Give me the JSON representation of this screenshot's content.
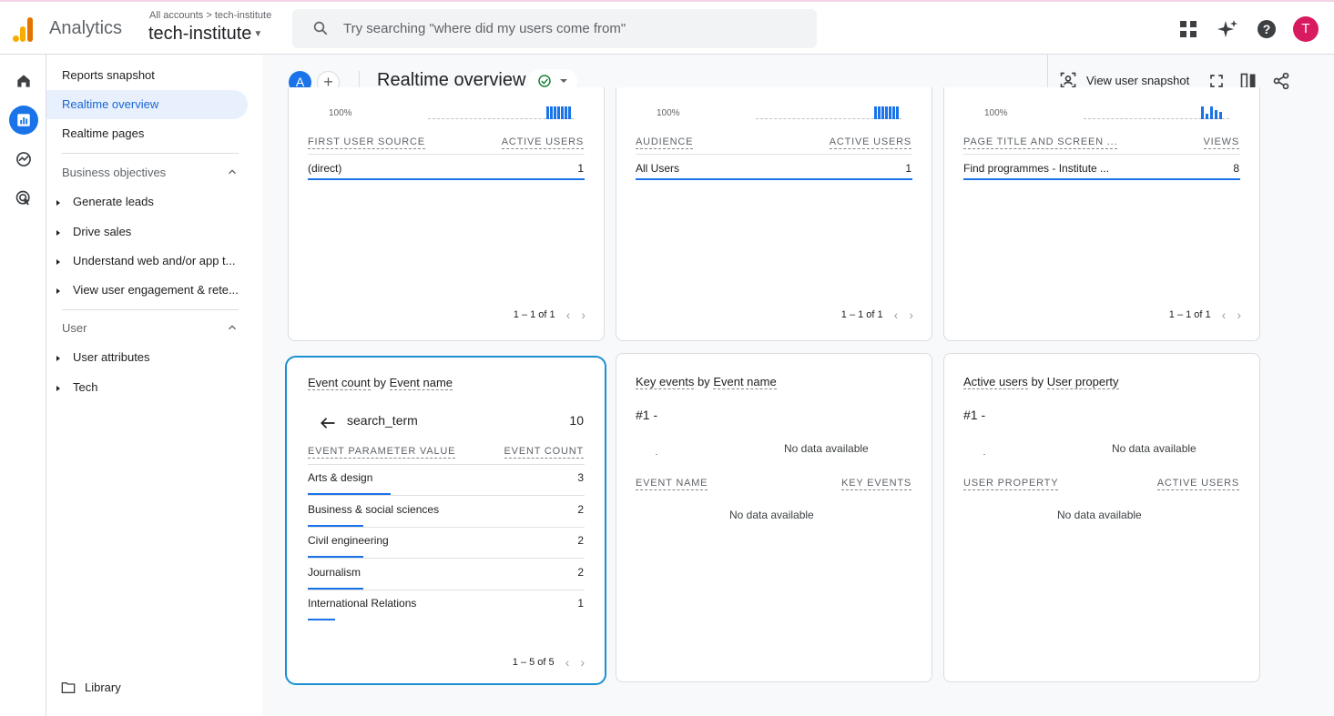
{
  "topbar": {
    "app_title": "Analytics",
    "breadcrumb": "All accounts > tech-institute",
    "property": "tech-institute",
    "search_placeholder": "Try searching \"where did my users come from\"",
    "avatar_letter": "T"
  },
  "nav": {
    "items": [
      {
        "label": "Reports snapshot"
      },
      {
        "label": "Realtime overview"
      },
      {
        "label": "Realtime pages"
      }
    ],
    "business_section": "Business objectives",
    "business_items": [
      "Generate leads",
      "Drive sales",
      "Understand web and/or app t...",
      "View user engagement & rete..."
    ],
    "user_section": "User",
    "user_items": [
      "User attributes",
      "Tech"
    ],
    "library": "Library"
  },
  "header": {
    "comparison_letter": "A",
    "add_symbol": "+",
    "title": "Realtime overview",
    "view_snapshot": "View user snapshot"
  },
  "cards_top": [
    {
      "pct": "100%",
      "col1": "FIRST USER SOURCE",
      "col2": "ACTIVE USERS",
      "row_label": "(direct)",
      "row_value": "1",
      "pager": "1 – 1 of 1"
    },
    {
      "pct": "100%",
      "col1": "AUDIENCE",
      "col2": "ACTIVE USERS",
      "row_label": "All Users",
      "row_value": "1",
      "pager": "1 – 1 of 1"
    },
    {
      "pct": "100%",
      "col1": "PAGE TITLE AND SCREEN ...",
      "col2": "VIEWS",
      "row_label": "Find programmes - Institute ...",
      "row_value": "8",
      "pager": "1 – 1 of 1"
    }
  ],
  "event_card": {
    "title_metric": "Event count",
    "title_by": "by",
    "title_dim": "Event name",
    "back_label": "search_term",
    "back_value": "10",
    "col1": "EVENT PARAMETER VALUE",
    "col2": "EVENT COUNT",
    "rows": [
      {
        "label": "Arts & design",
        "value": "3",
        "share": 0.3
      },
      {
        "label": "Business & social sciences",
        "value": "2",
        "share": 0.2
      },
      {
        "label": "Civil engineering",
        "value": "2",
        "share": 0.2
      },
      {
        "label": "Journalism",
        "value": "2",
        "share": 0.2
      },
      {
        "label": "International Relations",
        "value": "1",
        "share": 0.1
      }
    ],
    "pager": "1 – 5 of 5"
  },
  "key_events_card": {
    "title_metric": "Key events",
    "title_by": "by",
    "title_dim": "Event name",
    "rank": "#1",
    "dash": "-",
    "nodata_top": "No data available",
    "col1": "EVENT NAME",
    "col2": "KEY EVENTS",
    "nodata_table": "No data available"
  },
  "user_prop_card": {
    "title_metric": "Active users",
    "title_by": "by",
    "title_dim": "User property",
    "rank": "#1",
    "dash": "-",
    "nodata_top": "No data available",
    "col1": "USER PROPERTY",
    "col2": "ACTIVE USERS",
    "nodata_table": "No data available"
  },
  "colors": {
    "accent": "#1a73e8",
    "avatar": "#d81b60",
    "selected_border": "#1a8fd1"
  }
}
